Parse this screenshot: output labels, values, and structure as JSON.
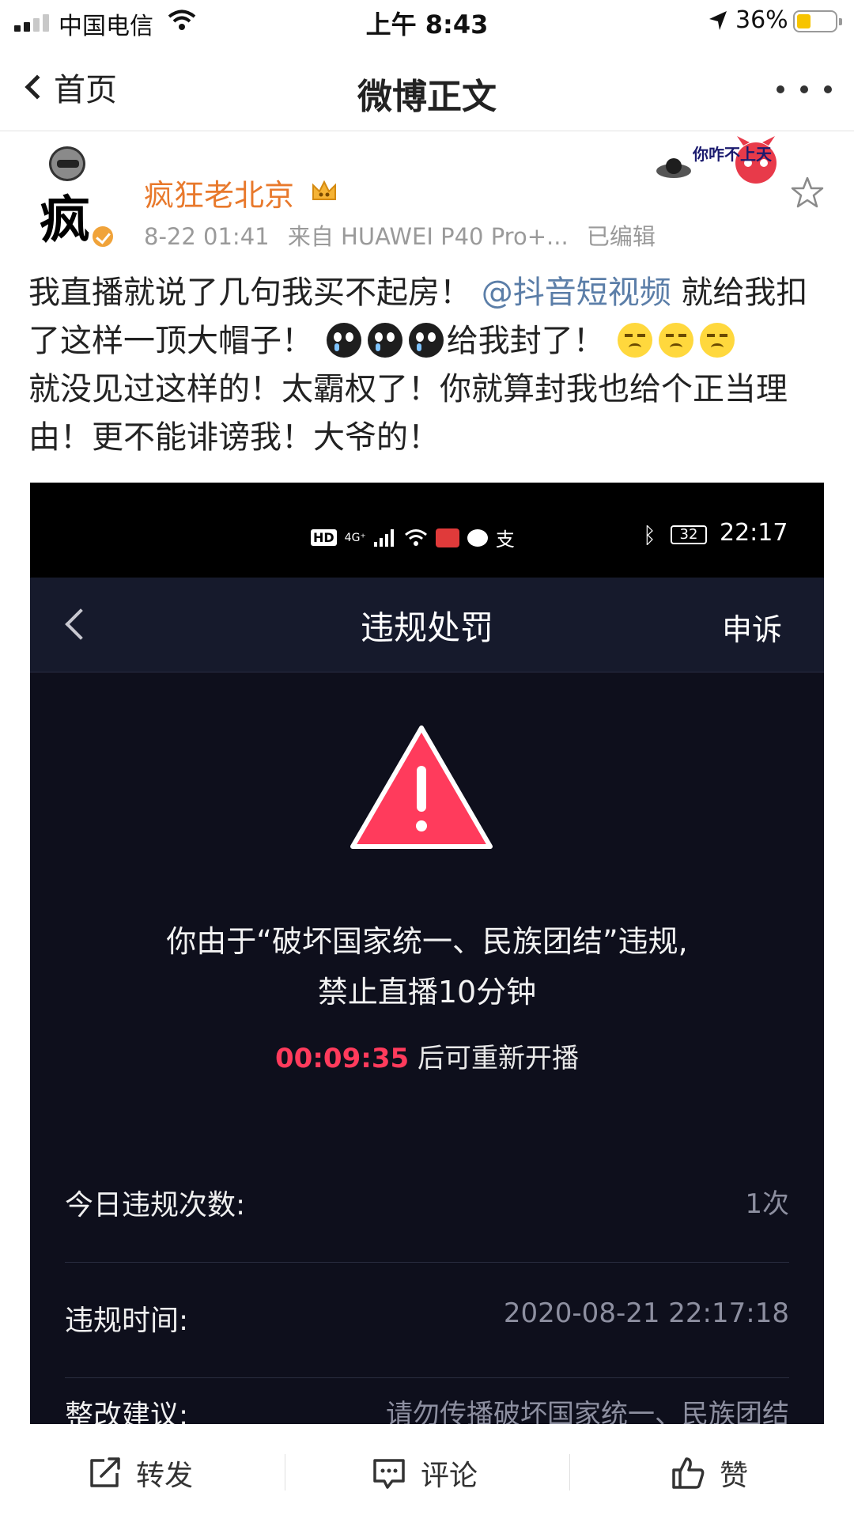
{
  "ios_status": {
    "carrier": "中国电信",
    "time": "上午 8:43",
    "battery_percent": "36%",
    "battery_level": 0.36,
    "signal_bars": 2
  },
  "nav": {
    "back_label": "首页",
    "title": "微博正文",
    "more_icon": "more-dots-icon"
  },
  "post": {
    "username": "疯狂老北京",
    "avatar_text": "疯",
    "timestamp": "8-22 01:41",
    "source": "来自 HUAWEI P40 Pro+...",
    "edited": "已编辑",
    "sticker_text": "你咋不上天",
    "text_part1": "我直播就说了几句我买不起房！",
    "mention": "@抖音短视频",
    "text_part2": " 就给我扣了这样一顶大帽子！",
    "text_part3": "给我封了！",
    "text_part4": "就没见过这样的！太霸权了！你就算封我也给个正当理由！更不能诽谤我！大爷的！"
  },
  "screenshot": {
    "status": {
      "hd": "HD",
      "net": "4G⁺",
      "zhi": "支",
      "battery": "32",
      "time": "22:17"
    },
    "nav": {
      "title": "违规处罚",
      "appeal": "申诉"
    },
    "penalty_line1": "你由于“破坏国家统一、民族团结”违规,",
    "penalty_line2": "禁止直播10分钟",
    "countdown": "00:09:35",
    "countdown_suffix": "后可重新开播",
    "rows": [
      {
        "label": "今日违规次数:",
        "value": "1次"
      },
      {
        "label": "违规时间:",
        "value": "2020-08-21 22:17:18"
      },
      {
        "label": "整改建议:",
        "value": "请勿传播破坏国家统一、民族团结"
      }
    ],
    "warning_color": "#ff3b5c"
  },
  "toolbar": {
    "repost": "转发",
    "comment": "评论",
    "like": "赞"
  },
  "colors": {
    "username": "#e8792c",
    "mention": "#5b7ea8",
    "screenshot_bg": "#0e0f1c",
    "countdown": "#ff3b5c"
  }
}
